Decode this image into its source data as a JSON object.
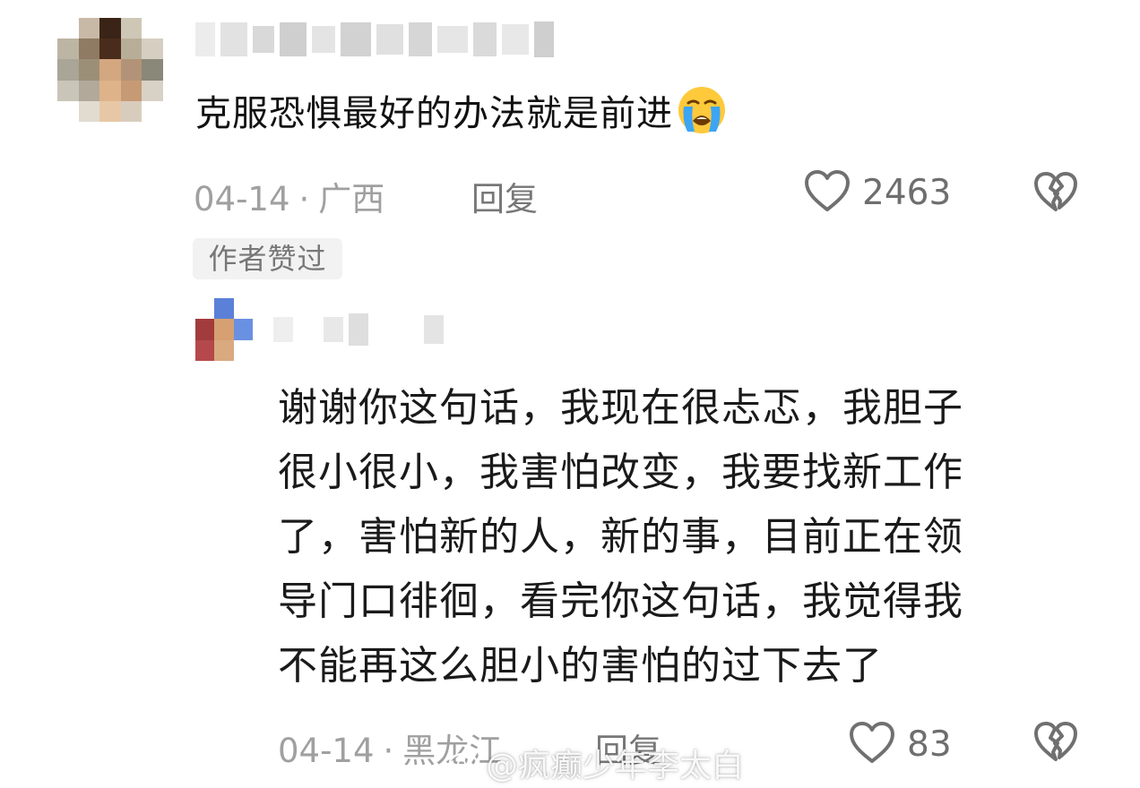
{
  "comment": {
    "text": "克服恐惧最好的办法就是前进",
    "emoji": "loudly-crying-face",
    "date": "04-14",
    "separator": "·",
    "location": "广西",
    "reply_label": "回复",
    "likes": "2463",
    "badge": "作者赞过",
    "avatar_colors": [
      "#6b5a4a",
      "#c8a585",
      "#b3b3a6",
      "#9a8c7a",
      "#d9cfc0",
      "#a67c5b"
    ]
  },
  "reply": {
    "lines": [
      "谢谢你这句话，我现在很忐忑，我胆子",
      "很小很小，我害怕改变，我要找新工作",
      "了，害怕新的人，新的事，目前正在领",
      "导门口徘徊，看完你这句话，我觉得我",
      "不能再这么胆小的害怕的过下去了"
    ],
    "date": "04-14",
    "separator": "·",
    "location": "黑龙江",
    "reply_label": "回复",
    "likes": "83",
    "avatar_colors": [
      "#5b7fd6",
      "#a23c3c",
      "#d8a070",
      "#6a8fe0"
    ]
  },
  "watermark": "@疯癫少年李太白",
  "colors": {
    "text_primary": "#111111",
    "text_meta": "#a0a0a0",
    "text_action": "#777777",
    "badge_bg": "#f2f2f2"
  }
}
